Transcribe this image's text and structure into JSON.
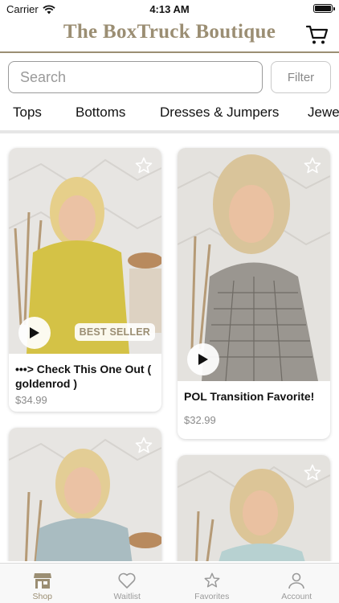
{
  "status_bar": {
    "carrier": "Carrier",
    "time": "4:13 AM"
  },
  "header": {
    "title": "The BoxTruck Boutique",
    "cart_icon": "cart-icon"
  },
  "search": {
    "placeholder": "Search",
    "filter_label": "Filter"
  },
  "categories": [
    {
      "label": "Tops"
    },
    {
      "label": "Bottoms"
    },
    {
      "label": "Dresses & Jumpers"
    },
    {
      "label": "Jewe"
    }
  ],
  "products": [
    {
      "title": "•••> Check This One Out ( goldenrod )",
      "price": "$34.99",
      "badge": "BEST SELLER",
      "has_video": true,
      "top_color": "#d4c246"
    },
    {
      "title": "POL Transition Favorite!",
      "price": "$32.99",
      "badge": "",
      "has_video": true,
      "top_color": "#9a9690"
    },
    {
      "title": "",
      "price": "",
      "badge": "",
      "has_video": false,
      "top_color": "#a9bcc1"
    },
    {
      "title": "",
      "price": "",
      "badge": "",
      "has_video": false,
      "top_color": "#b7d1d1"
    }
  ],
  "tab_bar": [
    {
      "label": "Shop",
      "icon": "shop-icon",
      "active": true
    },
    {
      "label": "Waitlist",
      "icon": "heart-icon",
      "active": false
    },
    {
      "label": "Favorites",
      "icon": "star-icon",
      "active": false
    },
    {
      "label": "Account",
      "icon": "person-icon",
      "active": false
    }
  ],
  "colors": {
    "brand": "#9b8e73",
    "inactive": "#9a9a9a",
    "background_wall": "#e7e5e2"
  }
}
